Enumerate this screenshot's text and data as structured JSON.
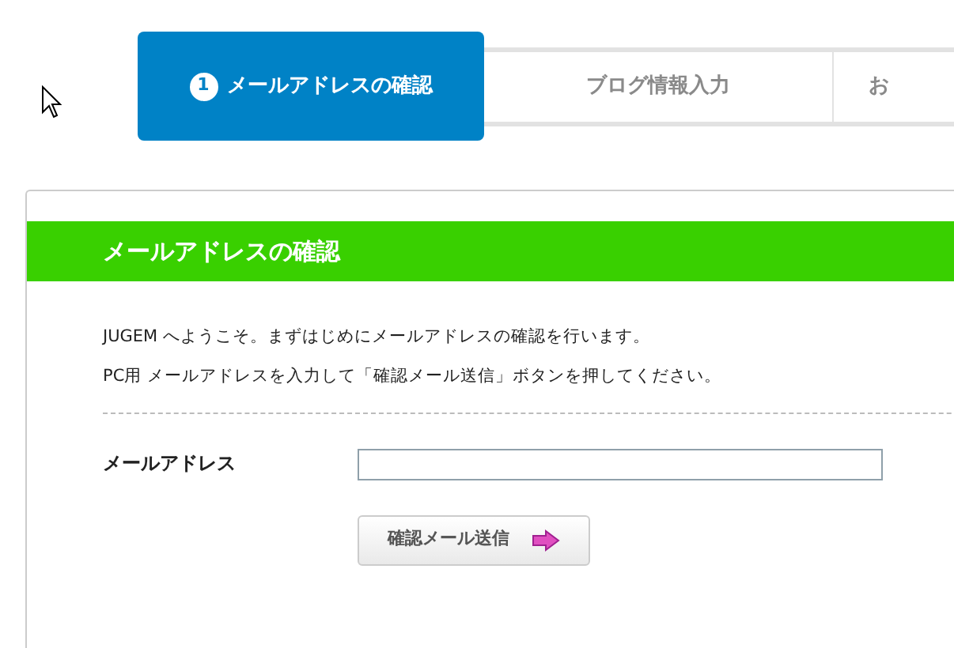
{
  "steps": [
    {
      "number": "1",
      "label": "メールアドレスの確認",
      "selected": true
    },
    {
      "label": "ブログ情報入力",
      "selected": false
    },
    {
      "label": "お",
      "selected": false
    }
  ],
  "panel": {
    "title": "メールアドレスの確認",
    "intro": [
      "JUGEM へようこそ。まずはじめにメールアドレスの確認を行います。",
      "PC用 メールアドレスを入力して「確認メール送信」ボタンを押してください。"
    ],
    "field": {
      "label": "メールアドレス"
    },
    "submit": "確認メール送信"
  }
}
